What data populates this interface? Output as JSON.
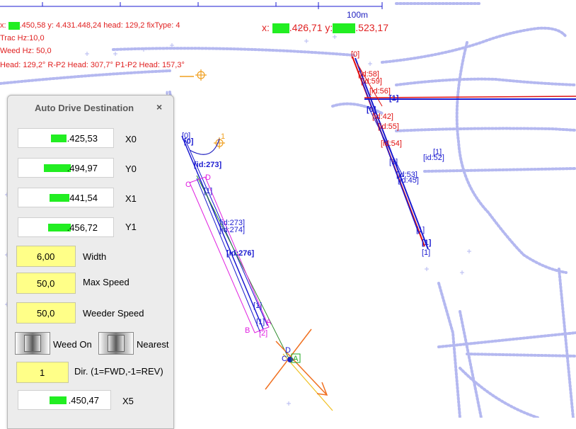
{
  "hud": {
    "line1": ".450,58 y: 4.431.448,24 head: 129,2 fixType: 4",
    "line1_prefix": "x: ",
    "trac_hz": "Trac Hz:10,0",
    "weed_hz": "Weed Hz: 50,0",
    "heading": "Head: 129,2° R-P2 Head: 307,7° P1-P2 Head: 157,3°",
    "pos_x_prefix": "x: ",
    "pos_x": ".426,71 y:",
    "pos_y": ".523,17",
    "scale": "100m"
  },
  "map_labels": {
    "a": "[0]",
    "b": "[0]",
    "c": "[id:273]",
    "d": "[id:274]",
    "e": "[id:273]",
    "f": "[id:276]",
    "g": "[1]",
    "h": "[1]",
    "i": "[1]",
    "j": "[2]",
    "k": "[0]",
    "l": "[id:58]",
    "m": "[id:59]",
    "n": "[id:56]",
    "o": "[1]",
    "p": "[0]",
    "q": "[id:42]",
    "r": "[id:55]",
    "s": "[id:54]",
    "t": "[1]",
    "u": "[1]",
    "v": "[id:52]",
    "w": "[id:53]",
    "x": "[id:45]",
    "y": "[1]",
    "z": "[1]",
    "aa": "[1]",
    "pt_d": "D",
    "pt_a": "A",
    "pt_b": "B",
    "pt_c": "C",
    "pt_one": "1",
    "marker_d": "D",
    "marker_a": "A",
    "marker_c": "C"
  },
  "panel": {
    "title": "Auto Drive Destination",
    "close": "×",
    "x0_value": ".425,53",
    "x0_label": "X0",
    "y0_value": ".494,97",
    "y0_label": "Y0",
    "x1_value": "441,54",
    "x1_label": "X1",
    "y1_value": ".456,72",
    "y1_label": "Y1",
    "width_value": "6,00",
    "width_label": "Width",
    "max_speed_value": "50,0",
    "max_speed_label": "Max Speed",
    "weeder_speed_value": "50,0",
    "weeder_speed_label": "Weeder Speed",
    "weed_on_label": "Weed On",
    "nearest_label": "Nearest",
    "dir_value": "1",
    "dir_label": "Dir. (1=FWD,-1=REV)",
    "x5_value": ".450,47",
    "x5_label": "X5"
  },
  "colors": {
    "hud_text": "#e02020",
    "redacted": "#22ee22",
    "input_yellow": "#ffff88",
    "track": "#b4b8f0",
    "line_blue": "#1a1ad0",
    "line_red": "#e01010",
    "magenta": "#e020e0"
  }
}
